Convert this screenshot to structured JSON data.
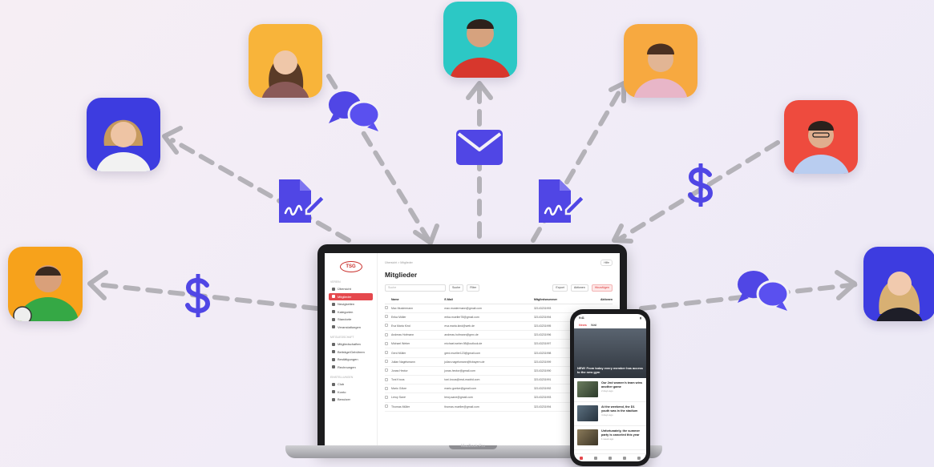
{
  "colors": {
    "accent": "#5046e5",
    "arrow": "#b4b2b8",
    "brand_red": "#e5484d"
  },
  "flow_icons": [
    "document-signature-icon",
    "chat-bubbles-icon",
    "envelope-icon",
    "document-signature-icon",
    "dollar-icon",
    "dollar-icon",
    "chat-bubbles-icon"
  ],
  "laptop": {
    "model_label": "MacBook Pro",
    "app": {
      "logo_text": "TSG",
      "breadcrumb": "Übersicht  >  Mitglieder",
      "help_label": "Hilfe",
      "title": "Mitglieder",
      "search_placeholder": "Suche",
      "search_button": "Suche",
      "filter_button": "Filter",
      "export_button": "Export",
      "actions_button": "Aktionen",
      "add_button": "Hinzufügen",
      "sidebar": {
        "group_1": "Verein",
        "items_1": [
          "Übersicht",
          "Mitglieder",
          "Neuigkeiten",
          "Kategorien",
          "Standorte",
          "Veranstaltungen"
        ],
        "group_2": "Mitgliedschaft",
        "items_2": [
          "Mitgliedschaften",
          "Beiträge/Gebühren",
          "Bestätigungen",
          "Rechnungen"
        ],
        "group_3": "Einstellungen",
        "items_3": [
          "Club",
          "Konto",
          "Benutzer"
        ]
      },
      "table": {
        "headers": [
          "Name",
          "E-Mail",
          "Mitgliedsnummer",
          "Aktionen"
        ],
        "rows": [
          [
            "Max Mustermann",
            "max.mustermann@gmail.com",
            "32143231993"
          ],
          [
            "Erika Müller",
            "erika.mueller78@gmail.com",
            "32143231994"
          ],
          [
            "Eva Maria Kind",
            "eva.maria.kind@web.de",
            "32143231995"
          ],
          [
            "Andreas Hofmann",
            "andreas.hofmann@gmx.de",
            "32143231996"
          ],
          [
            "Michael Weber",
            "michael.weber.98@outlook.de",
            "32143231997"
          ],
          [
            "Gerd Müller",
            "gerd.mueller123@gmail.com",
            "32143231998"
          ],
          [
            "Julian Nagelsmann",
            "julian.nagelsmann@fcbayern.de",
            "32143231999"
          ],
          [
            "Jonas Hector",
            "jonas.hector@gmail.com",
            "32143231990"
          ],
          [
            "Toni Kroos",
            "toni.kroos@real-madrid.com",
            "32143231991"
          ],
          [
            "Mario Götze",
            "mario.goetze@gmail.com",
            "32143231992"
          ],
          [
            "Leroy Sané",
            "leroy.sane@gmail.com",
            "32143231993"
          ],
          [
            "Thomas Müller",
            "thomas.mueller@gmail.com",
            "32143231994"
          ]
        ]
      }
    }
  },
  "phone": {
    "status_time": "9:41",
    "tabs": [
      "News",
      "Wall"
    ],
    "hero_title": "NEW! From today every member has access to the new gym",
    "cards": [
      {
        "title": "Our 2nd women's team wins another game",
        "meta": "2 days ago"
      },
      {
        "title": "At the weekend, the D1 youth was in the stadium",
        "meta": "4 days ago"
      },
      {
        "title": "Unfortunately, the summer party is canceled this year",
        "meta": "1 week ago"
      }
    ]
  }
}
